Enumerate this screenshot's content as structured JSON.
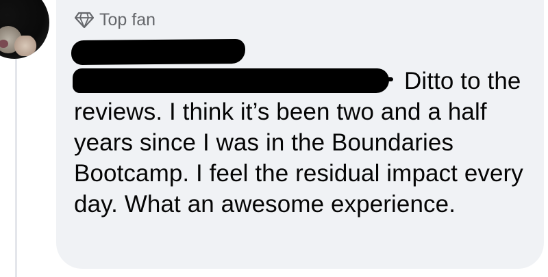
{
  "comment": {
    "badge_label": "Top fan",
    "badge_icon": "diamond-icon",
    "text": "Ditto to the reviews. I think it’s been two and a half years since I was in the Boundaries Bootcamp. I feel the residual impact every day. What an awesome experience."
  },
  "colors": {
    "bubble_bg": "#f0f2f5",
    "text": "#050505",
    "badge_text": "#65676b",
    "redaction": "#000000"
  }
}
